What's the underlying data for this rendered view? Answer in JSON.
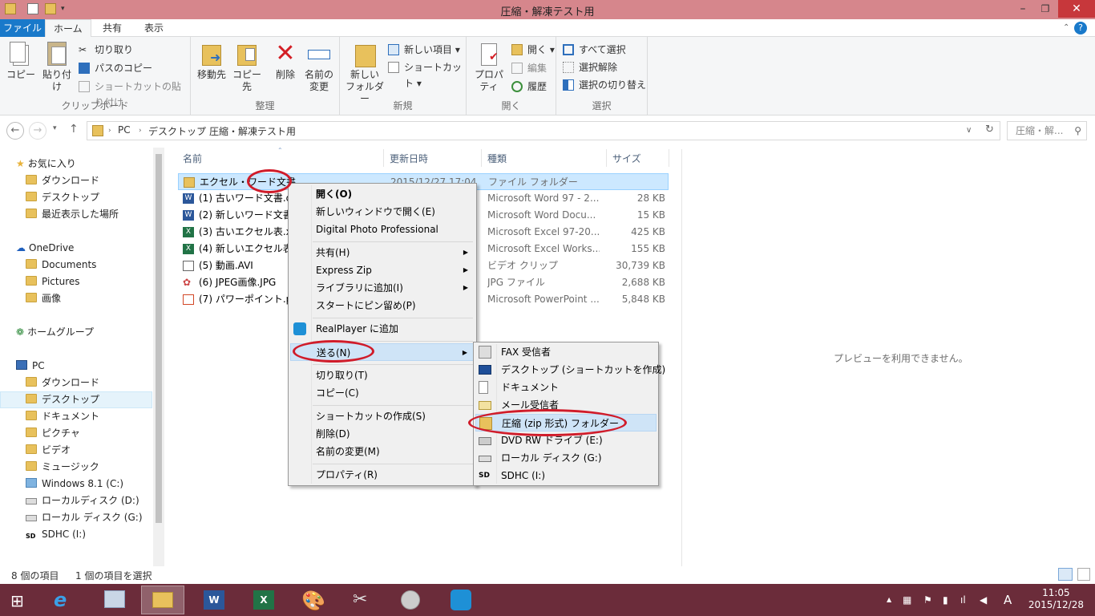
{
  "window": {
    "title": "圧縮・解凍テスト用"
  },
  "ribbon_tabs": [
    "ファイル",
    "ホーム",
    "共有",
    "表示"
  ],
  "ribbon": {
    "clipboard": {
      "label": "クリップボード",
      "copy": "コピー",
      "paste": "貼り付け",
      "cut": "切り取り",
      "copy_path": "パスのコピー",
      "paste_shortcut": "ショートカットの貼り付け"
    },
    "organize": {
      "label": "整理",
      "move_to": "移動先",
      "copy_to": "コピー先",
      "delete": "削除",
      "rename_1": "名前の",
      "rename_2": "変更"
    },
    "new": {
      "label": "新規",
      "new_folder_1": "新しい",
      "new_folder_2": "フォルダー",
      "new_item": "新しい項目",
      "shortcut": "ショートカット"
    },
    "open": {
      "label": "開く",
      "properties": "プロパティ",
      "open": "開く",
      "edit": "編集",
      "history": "履歴"
    },
    "select": {
      "label": "選択",
      "select_all": "すべて選択",
      "select_none": "選択解除",
      "invert": "選択の切り替え"
    }
  },
  "address": {
    "crumbs": [
      "PC",
      "デスクトップ",
      "圧縮・解凍テスト用"
    ],
    "search_placeholder": "圧縮・解..."
  },
  "nav": {
    "favorites": "お気に入り",
    "downloads": "ダウンロード",
    "desktop": "デスクトップ",
    "recent": "最近表示した場所",
    "onedrive": "OneDrive",
    "documents": "Documents",
    "pictures": "Pictures",
    "images": "画像",
    "homegroup": "ホームグループ",
    "pc": "PC",
    "pc_downloads": "ダウンロード",
    "pc_desktop": "デスクトップ",
    "pc_documents": "ドキュメント",
    "pc_pictures": "ピクチャ",
    "pc_videos": "ビデオ",
    "pc_music": "ミュージック",
    "drive_c": "Windows 8.1 (C:)",
    "drive_d": "ローカルディスク (D:)",
    "drive_g": "ローカル ディスク (G:)",
    "drive_i": "SDHC (I:)"
  },
  "columns": {
    "name": "名前",
    "date": "更新日時",
    "type": "種類",
    "size": "サイズ"
  },
  "files": [
    {
      "name": "エクセル・ワード文書",
      "date": "2015/12/27 17:04",
      "type": "ファイル フォルダー",
      "size": ""
    },
    {
      "name": "(1) 古いワード文書.do",
      "date": "",
      "type": "Microsoft Word 97 - 2...",
      "size": "28 KB"
    },
    {
      "name": "(2) 新しいワード文書.d",
      "date": "",
      "type": "Microsoft Word Docu...",
      "size": "15 KB"
    },
    {
      "name": "(3) 古いエクセル表.xls",
      "date": "",
      "type": "Microsoft Excel 97-20...",
      "size": "425 KB"
    },
    {
      "name": "(4) 新しいエクセル表.x",
      "date": "",
      "type": "Microsoft Excel Works...",
      "size": "155 KB"
    },
    {
      "name": "(5) 動画.AVI",
      "date": "",
      "type": "ビデオ クリップ",
      "size": "30,739 KB"
    },
    {
      "name": "(6)  JPEG画像.JPG",
      "date": "",
      "type": "JPG ファイル",
      "size": "2,688 KB"
    },
    {
      "name": "(7) パワーポイント.ppt",
      "date": "",
      "type": "Microsoft PowerPoint ...",
      "size": "5,848 KB"
    }
  ],
  "context_menu": {
    "open": "開く(O)",
    "open_new_window": "新しいウィンドウで開く(E)",
    "dpp": "Digital Photo Professional",
    "share": "共有(H)",
    "express_zip": "Express Zip",
    "add_to_library": "ライブラリに追加(I)",
    "pin_start": "スタートにピン留め(P)",
    "realplayer": "RealPlayer に追加",
    "send_to": "送る(N)",
    "cut": "切り取り(T)",
    "copy": "コピー(C)",
    "create_shortcut": "ショートカットの作成(S)",
    "delete": "削除(D)",
    "rename": "名前の変更(M)",
    "properties": "プロパティ(R)"
  },
  "send_to_menu": {
    "fax": "FAX 受信者",
    "desktop": "デスクトップ (ショートカットを作成)",
    "documents": "ドキュメント",
    "mail": "メール受信者",
    "zip": "圧縮 (zip 形式) フォルダー",
    "dvd": "DVD RW ドライブ (E:)",
    "local_g": "ローカル ディスク (G:)",
    "sdhc": "SDHC (I:)"
  },
  "preview_text": "プレビューを利用できません。",
  "status": {
    "count": "8 個の項目",
    "selected": "1 個の項目を選択"
  },
  "clock": {
    "time": "11:05",
    "date": "2015/12/28"
  },
  "tray_ime": "A",
  "colors": {
    "titlebar": "#d6868c",
    "close": "#c7373b",
    "file_tab": "#1979ca",
    "taskbar": "#6b2c3a",
    "selection": "#cce8ff",
    "annotation": "#d01c2a"
  }
}
